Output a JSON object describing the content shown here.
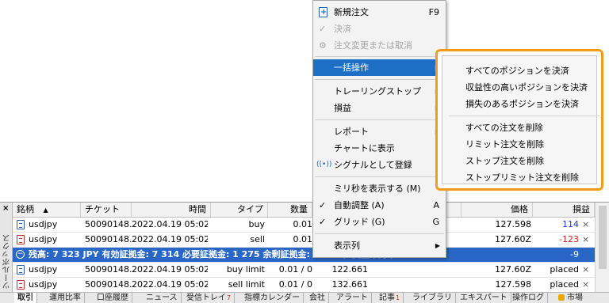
{
  "context_menu": {
    "items": [
      {
        "label": "新規注文",
        "shortcut": "F9",
        "icon": "new-order-icon"
      },
      {
        "label": "決済",
        "icon": "check-icon",
        "disabled": true
      },
      {
        "label": "注文変更または取消",
        "icon": "gear-icon",
        "disabled": true
      },
      {
        "label": "一括操作",
        "arrow": "▶",
        "highlighted": true
      },
      {
        "label": "トレーリングストップ",
        "arrow": "▶"
      },
      {
        "label": "損益",
        "arrow": "▶"
      },
      {
        "label": "レポート",
        "arrow": "▶"
      },
      {
        "label": "チャートに表示"
      },
      {
        "label": "シグナルとして登録",
        "icon": "signal-icon"
      },
      {
        "label": "ミリ秒を表示する (M)"
      },
      {
        "label": "自動調整 (A)",
        "shortcut": "A",
        "check": "✓"
      },
      {
        "label": "グリッド (G)",
        "shortcut": "G",
        "check": "✓"
      },
      {
        "label": "表示列",
        "arrow": "▶"
      }
    ]
  },
  "submenu": {
    "items": [
      "すべてのポジションを決済",
      "収益性の高いポジションを決済",
      "損失のあるポジションを決済",
      "すべての注文を削除",
      "リミット注文を削除",
      "ストップ注文を削除",
      "ストップリミット注文を削除"
    ]
  },
  "terminal": {
    "close_glyph": "×",
    "vertical_title": "ツールボックス",
    "columns": [
      "銘柄",
      "チケット",
      "時間",
      "タイプ",
      "数量",
      "",
      "価格指値(...",
      "価格",
      "損益"
    ],
    "sort_arrow": "▲",
    "rows": [
      {
        "symbol": "usdjpy",
        "ticket": "50090148...",
        "time": "2022.04.19 05:02:05",
        "type": "buy",
        "volume": "0.01",
        "price": "127.598",
        "profit": "114",
        "profit_color": "blue"
      },
      {
        "symbol": "usdjpy",
        "ticket": "50090148...",
        "time": "2022.04.19 05:02:12",
        "type": "sell",
        "volume": "0.01",
        "price": "127.60Z",
        "profit": "-123",
        "profit_color": "red"
      },
      {
        "summary": "残高: 7 323 JPY  有効証拠金: 7 314  必要証拠金: 1 275  余剰証拠金: 6 039  証拠金維持率: 573.65 %",
        "profit": "-9"
      },
      {
        "symbol": "usdjpy",
        "ticket": "50090148...",
        "time": "2022.04.19 05:02:16",
        "type": "buy limit",
        "volume": "0.01 / 0",
        "order_price": "122.661",
        "price": "127.60Z",
        "profit": "placed"
      },
      {
        "symbol": "usdjpy",
        "ticket": "50090148...",
        "time": "2022.04.19 05:02:19",
        "type": "sell limit",
        "volume": "0.01 / 0",
        "order_price": "132.661",
        "price": "127.598",
        "profit": "placed"
      }
    ],
    "tabs": [
      {
        "label": "取引"
      },
      {
        "label": "運用比率"
      },
      {
        "label": "口座履歴"
      },
      {
        "label": "ニュース"
      },
      {
        "label": "受信トレイ",
        "badge": "7"
      },
      {
        "label": "指標カレンダー"
      },
      {
        "label": "会社"
      },
      {
        "label": "アラート"
      },
      {
        "label": "記事",
        "badge": "1"
      },
      {
        "label": "ライブラリ"
      },
      {
        "label": "エキスパート"
      },
      {
        "label": "操作ログ"
      },
      {
        "label": "市場"
      }
    ]
  }
}
